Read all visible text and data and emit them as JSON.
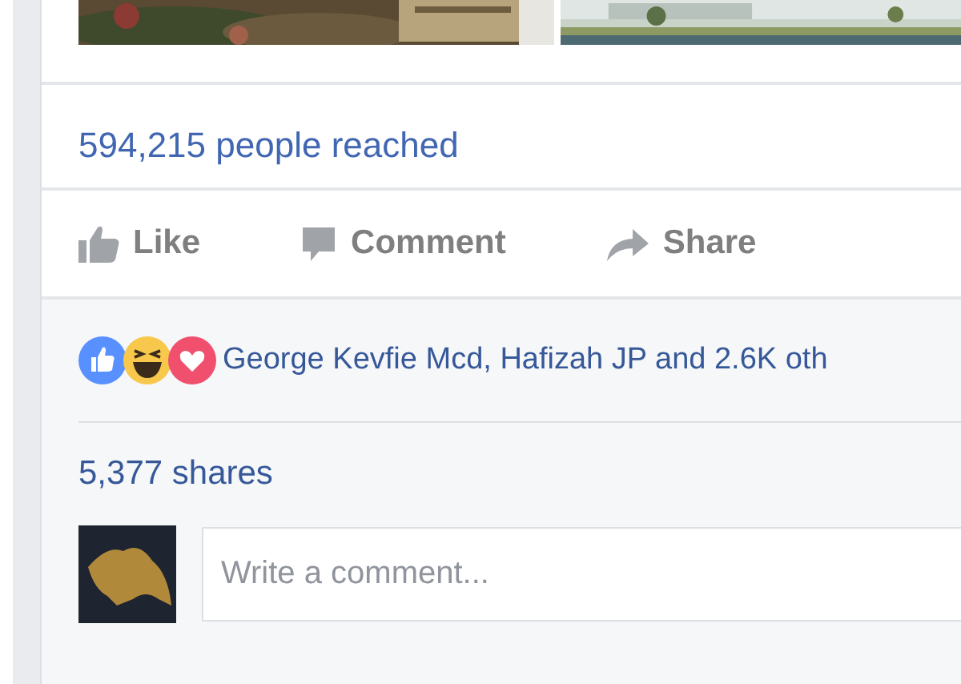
{
  "reach": "594,215 people reached",
  "actions": [
    {
      "kind": "like",
      "label": "Like"
    },
    {
      "kind": "comment",
      "label": "Comment"
    },
    {
      "kind": "share",
      "label": "Share"
    }
  ],
  "reactions": {
    "icons": [
      {
        "kind": "like"
      },
      {
        "kind": "haha"
      },
      {
        "kind": "love"
      }
    ],
    "text": "George Kevfie Mcd, Hafizah JP and 2.6K oth"
  },
  "shares": "5,377 shares",
  "comment_box": {
    "placeholder": "Write a comment..."
  }
}
